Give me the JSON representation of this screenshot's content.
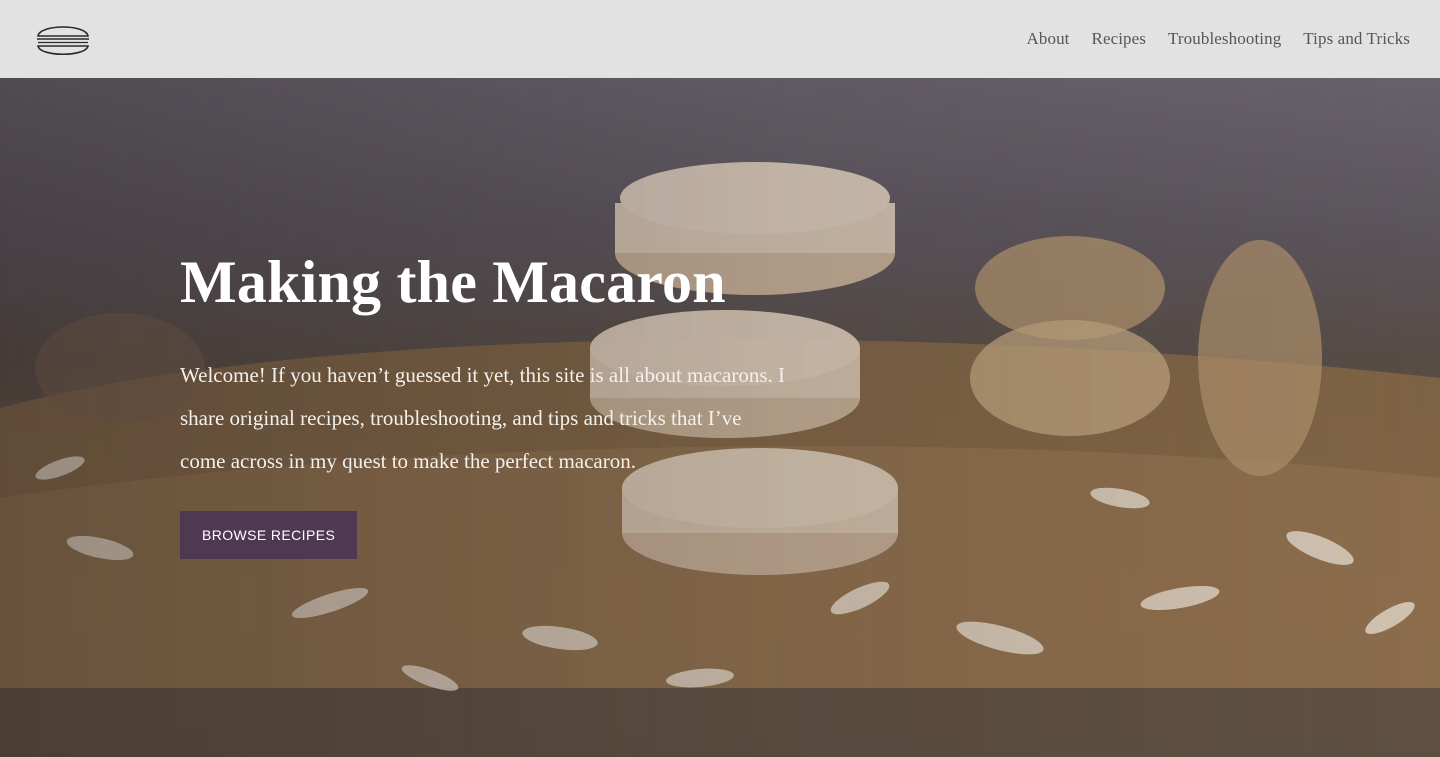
{
  "header": {
    "logo_icon": "macaron-icon",
    "nav": [
      {
        "label": "About"
      },
      {
        "label": "Recipes"
      },
      {
        "label": "Troubleshooting"
      },
      {
        "label": "Tips and Tricks"
      }
    ]
  },
  "hero": {
    "title": "Making the Macaron",
    "text": "Welcome! If you haven’t guessed it yet, this site is all about macarons. I share original recipes, troubleshooting, and tips and tricks that I’ve come across in my quest to make the perfect macaron.",
    "cta_label": "BROWSE RECIPES",
    "cta_color": "#4f3852"
  }
}
